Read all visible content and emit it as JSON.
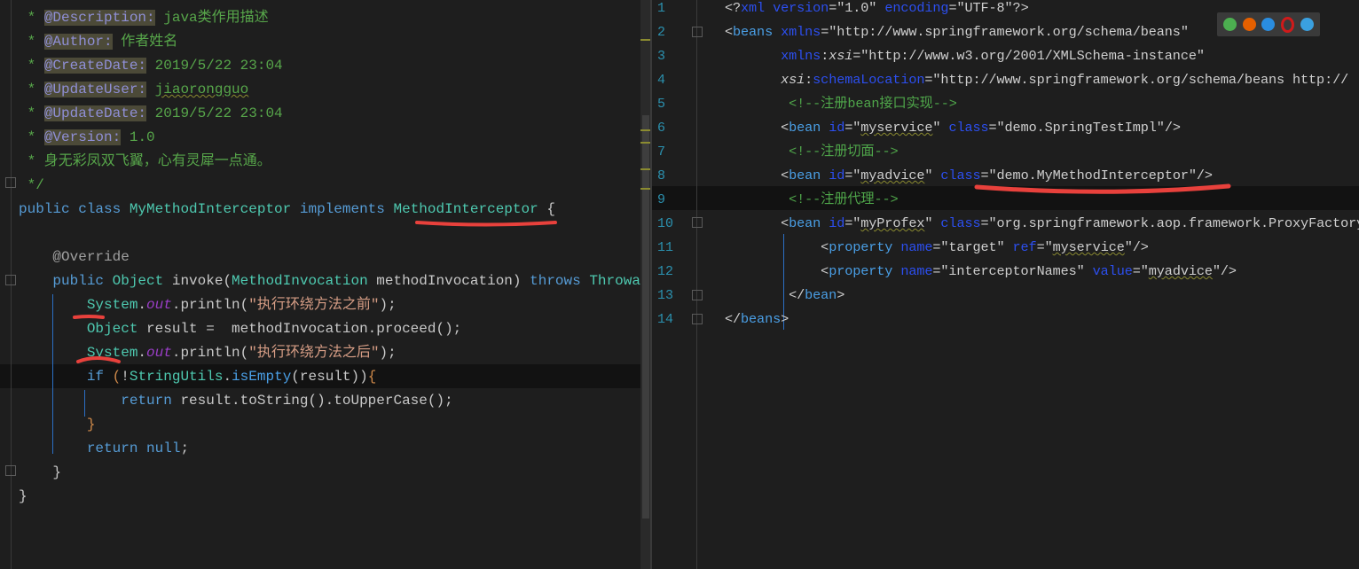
{
  "left_editor": {
    "lines": [
      [
        [
          " * ",
          "c"
        ],
        [
          "@Description:",
          "tag"
        ],
        [
          " java类作用描述",
          "c"
        ]
      ],
      [
        [
          " * ",
          "c"
        ],
        [
          "@Author:",
          "tag"
        ],
        [
          " 作者姓名",
          "c"
        ]
      ],
      [
        [
          " * ",
          "c"
        ],
        [
          "@CreateDate:",
          "tag"
        ],
        [
          " 2019/5/22 23:04",
          "c"
        ]
      ],
      [
        [
          " * ",
          "c"
        ],
        [
          "@UpdateUser:",
          "tag"
        ],
        [
          " ",
          "c"
        ],
        [
          "jiaorongguo",
          "c sq"
        ]
      ],
      [
        [
          " * ",
          "c"
        ],
        [
          "@UpdateDate:",
          "tag"
        ],
        [
          " 2019/5/22 23:04",
          "c"
        ]
      ],
      [
        [
          " * ",
          "c"
        ],
        [
          "@Version:",
          "tag"
        ],
        [
          " 1.0",
          "c"
        ]
      ],
      [
        [
          " * 身无彩凤双飞翼，心有灵犀一点通。",
          "c"
        ]
      ],
      [
        [
          " */",
          "c"
        ]
      ],
      [
        [
          "public class ",
          "kw"
        ],
        [
          "MyMethodInterceptor",
          "cls"
        ],
        [
          " implements ",
          "kw"
        ],
        [
          "MethodInterceptor",
          "cls"
        ],
        [
          " {",
          "t"
        ]
      ],
      [],
      [
        [
          "    @Override",
          "ann"
        ]
      ],
      [
        [
          "    public ",
          "kw"
        ],
        [
          "Object",
          "cls"
        ],
        [
          " invoke(",
          "t"
        ],
        [
          "MethodInvocation",
          "cls"
        ],
        [
          " methodInvocation) ",
          "t"
        ],
        [
          "throws ",
          "kw"
        ],
        [
          "Throwable",
          "cls"
        ]
      ],
      [
        [
          "        ",
          "t"
        ],
        [
          "System",
          "cls"
        ],
        [
          ".",
          "t"
        ],
        [
          "out",
          "out"
        ],
        [
          ".println(",
          "t"
        ],
        [
          "\"执行环绕方法之前\"",
          "s"
        ],
        [
          ");",
          "t"
        ]
      ],
      [
        [
          "        ",
          "t"
        ],
        [
          "Object",
          "cls"
        ],
        [
          " result =  methodInvocation.proceed();",
          "t"
        ]
      ],
      [
        [
          "        ",
          "t"
        ],
        [
          "System",
          "cls"
        ],
        [
          ".",
          "t"
        ],
        [
          "out",
          "out"
        ],
        [
          ".println(",
          "t"
        ],
        [
          "\"执行环绕方法之后\"",
          "s"
        ],
        [
          ");",
          "t"
        ]
      ],
      [
        [
          "        if ",
          "kw"
        ],
        [
          "(",
          "br"
        ],
        [
          "!",
          "t"
        ],
        [
          "StringUtils",
          "cls"
        ],
        [
          ".",
          "t"
        ],
        [
          "isEmpty",
          "xt"
        ],
        [
          "(result))",
          "t"
        ],
        [
          "{",
          "br"
        ]
      ],
      [
        [
          "            return ",
          "kw"
        ],
        [
          "result.toString().toUpperCase();",
          "t"
        ]
      ],
      [
        [
          "        }",
          "br"
        ]
      ],
      [
        [
          "        return null",
          "kw"
        ],
        [
          ";",
          "t"
        ]
      ],
      [
        [
          "    }",
          "t"
        ]
      ],
      [
        [
          "}",
          "t"
        ]
      ]
    ]
  },
  "right_editor": {
    "line_numbers": [
      "1",
      "2",
      "3",
      "4",
      "5",
      "6",
      "7",
      "8",
      "9",
      "10",
      "11",
      "12",
      "13",
      "14"
    ],
    "lines": [
      [
        [
          "<?",
          "xv"
        ],
        [
          "xml",
          "xa"
        ],
        [
          " ",
          "xv"
        ],
        [
          "version",
          "xa"
        ],
        [
          "=\"1.0\" ",
          "xv"
        ],
        [
          "encoding",
          "xa"
        ],
        [
          "=\"UTF-8\"?>",
          "xv"
        ]
      ],
      [
        [
          "<",
          "xv"
        ],
        [
          "beans",
          "xt"
        ],
        [
          " ",
          "xv"
        ],
        [
          "xmlns",
          "xa"
        ],
        [
          "=\"http://www.springframework.org/schema/beans\"",
          "xv"
        ]
      ],
      [
        [
          "       ",
          "xv"
        ],
        [
          "xmlns",
          "xa"
        ],
        [
          ":",
          "xv"
        ],
        [
          "xsi",
          "xi"
        ],
        [
          "=\"http://www.w3.org/2001/XMLSchema-instance\"",
          "xv"
        ]
      ],
      [
        [
          "       ",
          "xv"
        ],
        [
          "xsi",
          "xi"
        ],
        [
          ":",
          "xv"
        ],
        [
          "schemaLocation",
          "xa"
        ],
        [
          "=\"http://www.springframework.org/schema/beans http://",
          "xv"
        ]
      ],
      [
        [
          "        <!--注册bean接口实现-->",
          "xc"
        ]
      ],
      [
        [
          "       <",
          "xv"
        ],
        [
          "bean",
          "xt"
        ],
        [
          " ",
          "xv"
        ],
        [
          "id",
          "xa"
        ],
        [
          "=\"",
          "xv"
        ],
        [
          "myservice",
          "xv sq"
        ],
        [
          "\" ",
          "xv"
        ],
        [
          "class",
          "xa"
        ],
        [
          "=\"demo.SpringTestImpl\"/>",
          "xv"
        ]
      ],
      [
        [
          "        <!--注册切面-->",
          "xc"
        ]
      ],
      [
        [
          "       <",
          "xv"
        ],
        [
          "bean",
          "xt"
        ],
        [
          " ",
          "xv"
        ],
        [
          "id",
          "xa"
        ],
        [
          "=\"",
          "xv"
        ],
        [
          "myadvice",
          "xv sq"
        ],
        [
          "\" ",
          "xv"
        ],
        [
          "class",
          "xa"
        ],
        [
          "=\"demo.MyMethodInterceptor\"/>",
          "xv"
        ]
      ],
      [
        [
          "        <!--注册代理-->",
          "xc"
        ]
      ],
      [
        [
          "       <",
          "xv"
        ],
        [
          "bean",
          "xt"
        ],
        [
          " ",
          "xv"
        ],
        [
          "id",
          "xa"
        ],
        [
          "=\"",
          "xv"
        ],
        [
          "myProfex",
          "xv sq"
        ],
        [
          "\" ",
          "xv"
        ],
        [
          "class",
          "xa"
        ],
        [
          "=\"org.springframework.aop.framework.ProxyFactoryBean\">",
          "xv"
        ]
      ],
      [
        [
          "            <",
          "xv"
        ],
        [
          "property",
          "xt"
        ],
        [
          " ",
          "xv"
        ],
        [
          "name",
          "xa"
        ],
        [
          "=\"target\" ",
          "xv"
        ],
        [
          "ref",
          "xa"
        ],
        [
          "=\"",
          "xv"
        ],
        [
          "myservice",
          "xv sq"
        ],
        [
          "\"/>",
          "xv"
        ]
      ],
      [
        [
          "            <",
          "xv"
        ],
        [
          "property",
          "xt"
        ],
        [
          " ",
          "xv"
        ],
        [
          "name",
          "xa"
        ],
        [
          "=\"interceptorNames\" ",
          "xv"
        ],
        [
          "value",
          "xa"
        ],
        [
          "=\"",
          "xv"
        ],
        [
          "myadvice",
          "xv sq"
        ],
        [
          "\"/>",
          "xv"
        ]
      ],
      [
        [
          "        </",
          "xv"
        ],
        [
          "bean",
          "xt"
        ],
        [
          ">",
          "xv"
        ]
      ],
      [
        [
          "</",
          "xv"
        ],
        [
          "beans",
          "xt"
        ],
        [
          ">",
          "xv"
        ]
      ]
    ]
  },
  "browser_icons": [
    "chrome-icon",
    "firefox-icon",
    "safari-icon",
    "opera-icon",
    "ie-icon"
  ],
  "colors": {
    "chrome": "#4caf50",
    "firefox": "#e66000",
    "safari": "#2a8de0",
    "opera": "#d01a1a",
    "ie": "#3aa0e0",
    "annotation": "#e8413c"
  }
}
